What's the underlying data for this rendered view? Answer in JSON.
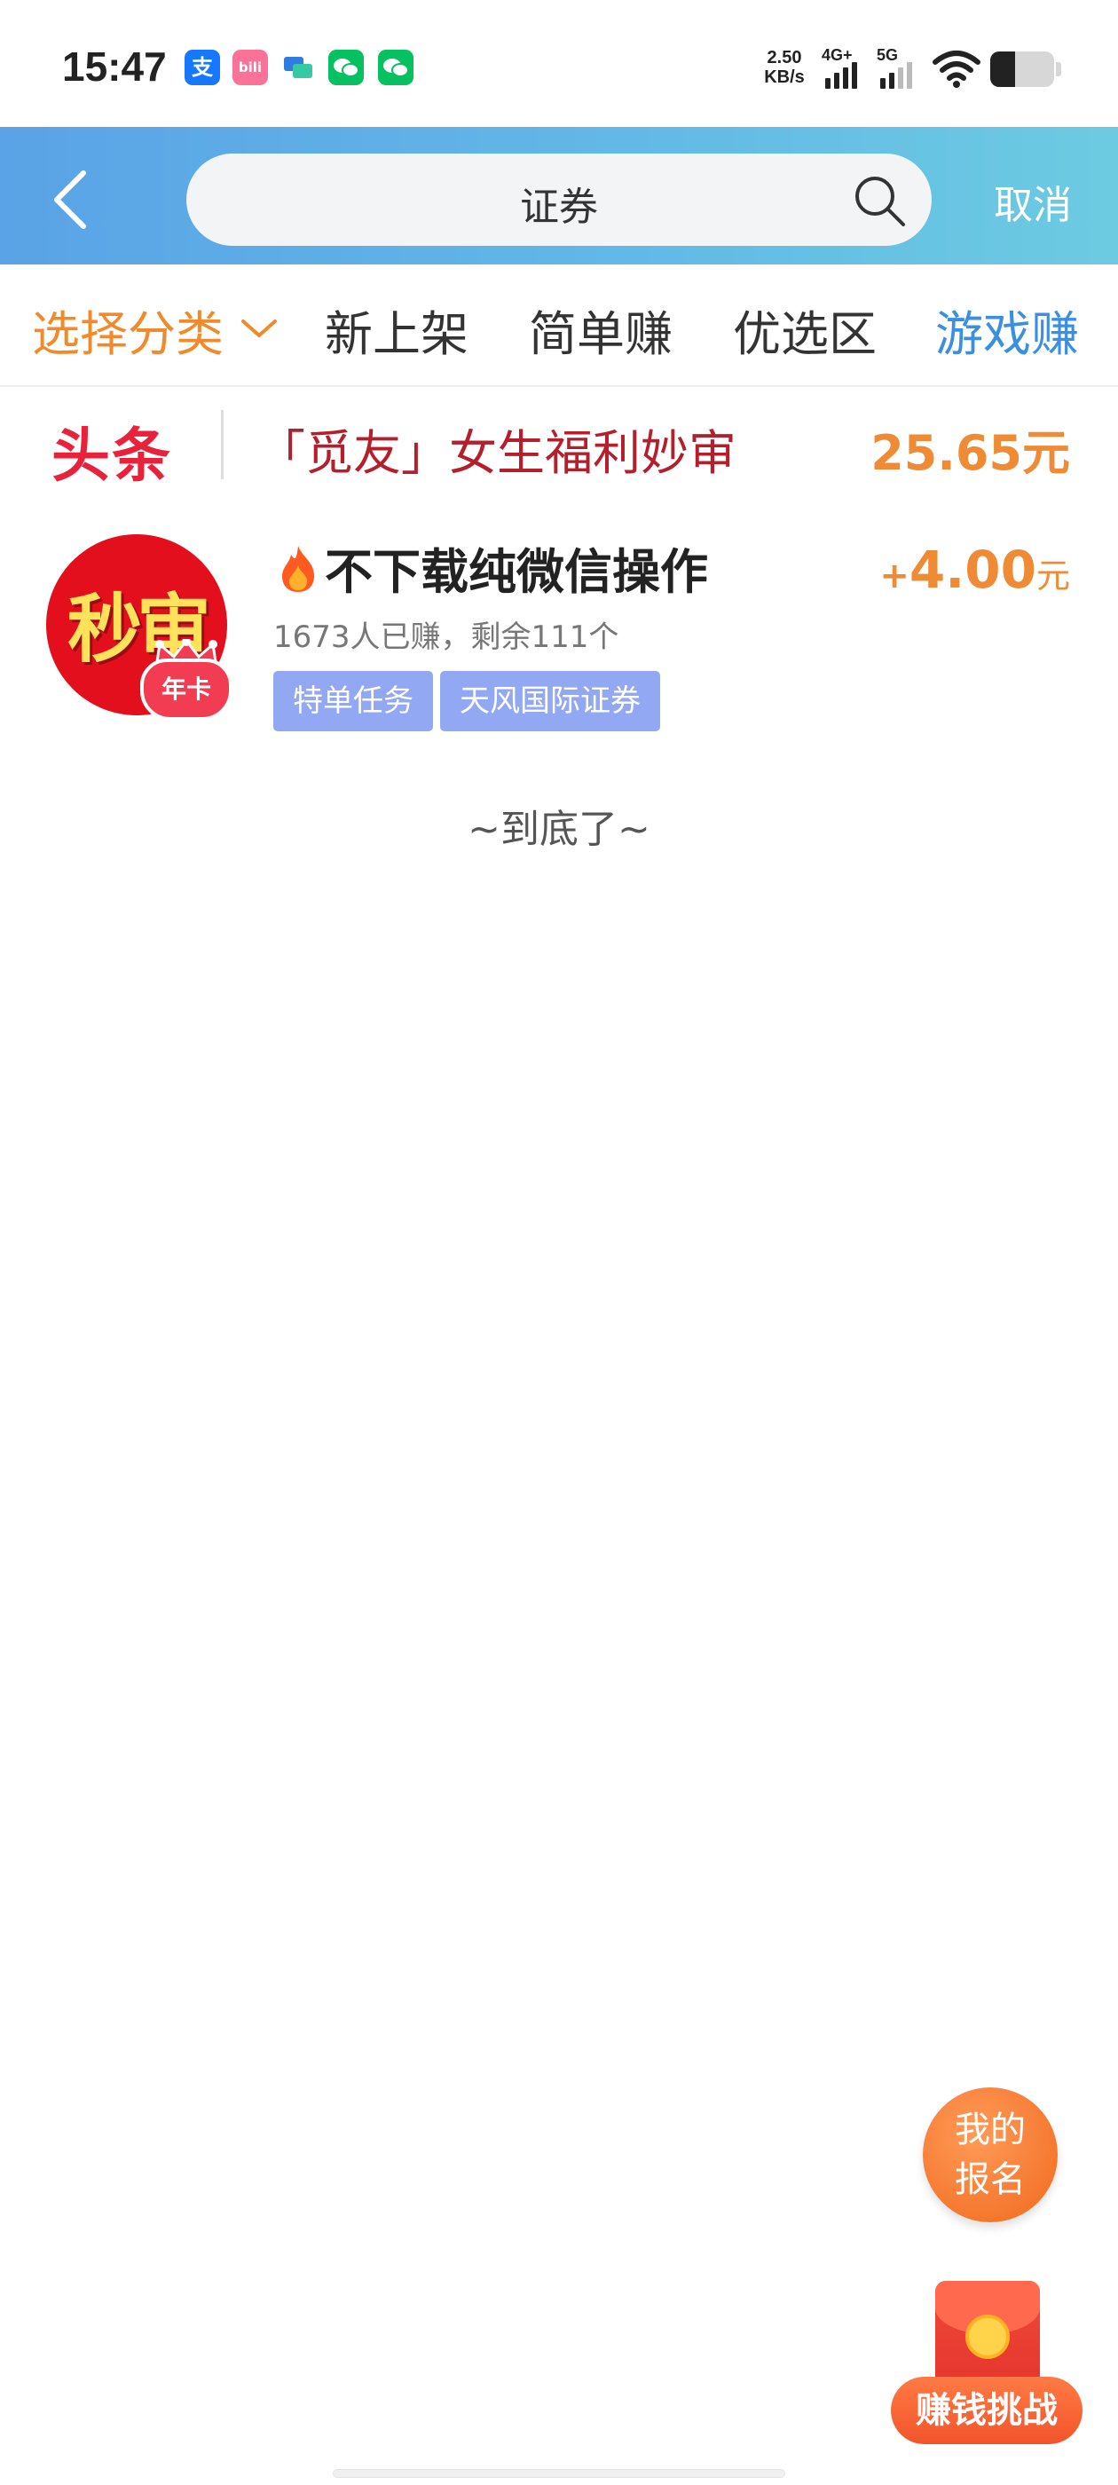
{
  "status_bar": {
    "time": "15:47",
    "net_speed_value": "2.50",
    "net_speed_unit": "KB/s",
    "signal_1_label": "4G+",
    "signal_2_label": "5G",
    "notification_icons": [
      "alipay-icon",
      "bilibili-icon",
      "chat-bubbles-icon",
      "wechat-icon",
      "wechat-icon"
    ],
    "colors": {
      "alipay": "#1677ff",
      "bilibili": "#fb7299",
      "wechat": "#07c160"
    }
  },
  "search": {
    "query": "证券",
    "cancel_label": "取消"
  },
  "tabs": {
    "category_label": "选择分类",
    "items": [
      "新上架",
      "简单赚",
      "优选区",
      "游戏赚"
    ],
    "active_index": 3
  },
  "banner": {
    "logo_text": "头条",
    "title": "「觅友」女生福利妙审",
    "reward": "25.65元"
  },
  "task": {
    "avatar_text": "秒审",
    "avatar_badge": "年卡",
    "title": "不下载纯微信操作",
    "stats": "1673人已赚，剩余111个",
    "tags": [
      "特单任务",
      "天风国际证券"
    ],
    "price_plus": "+",
    "price_amount": "4.00",
    "price_unit": "元"
  },
  "list_end": "~到底了~",
  "floating": {
    "signup_line1": "我的",
    "signup_line2": "报名",
    "challenge_label": "赚钱挑战"
  },
  "theme": {
    "header_gradient_start": "#5aa3e6",
    "header_gradient_end": "#6ccbe1",
    "accent_orange": "#ef8b34",
    "accent_blue": "#3a8fe0",
    "tag_color": "#92a8f2"
  }
}
